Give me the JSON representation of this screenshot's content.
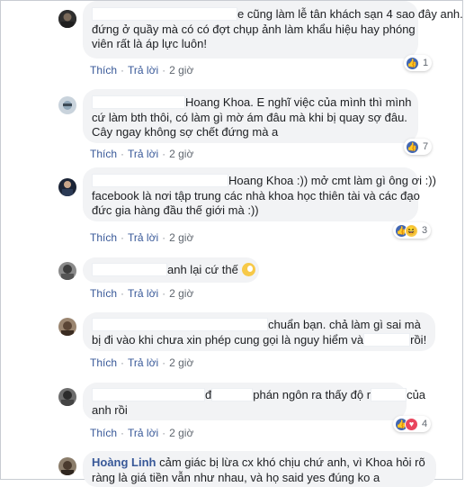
{
  "actions": {
    "like": "Thích",
    "reply": "Trả lời",
    "time": "2 giờ",
    "separator": "·"
  },
  "comments": [
    {
      "lines": [
        "e cũng làm lễ tân khách sạn 4 sao đây anh.",
        "đứng ở quầy mà có có đợt chụp ảnh làm khẩu hiệu hay phóng",
        "viên rất là áp lực luôn!"
      ],
      "reactions": {
        "count": "1"
      }
    },
    {
      "mention": "Hoang Khoa",
      "lines": [
        ". E nghĩ việc của mình thì mình",
        "cứ làm bth thôi, có làm gì mờ ám đâu mà khi bị quay sợ đâu.",
        "Cây ngay không sợ chết đứng mà a"
      ],
      "reactions": {
        "count": "7"
      }
    },
    {
      "mention": "Hoang Khoa",
      "lines": [
        " :)) mở cmt làm gì ông ơi :))",
        "facebook là nơi tập trung các nhà khoa học thiên tài và các đạo",
        "đức gia hàng đầu thế giới mà :))"
      ],
      "reactions": {
        "count": "3"
      }
    },
    {
      "lines": [
        "anh lại cứ thế"
      ],
      "reactions": null
    },
    {
      "lines": [
        "chuẩn bạn. chả làm gì sai mà",
        "bị đi vào khi chưa xin phép cung gọi là nguy hiểm và",
        "rồi!"
      ],
      "reactions": null
    },
    {
      "lines": [
        "đ",
        "phán ngôn ra thấy độ r",
        "của",
        "anh rồi"
      ],
      "reactions": {
        "count": "4"
      }
    },
    {
      "name": "Hoàng Linh",
      "lines": [
        " cảm giác bị lừa cx khó chịu chứ anh, vì Khoa hỏi rõ",
        "ràng là giá tiền vẫn như nhau, và họ said yes đúng ko a"
      ],
      "reactions": null
    }
  ],
  "icons": {
    "like": "like-icon",
    "haha": "haha-icon",
    "love": "love-icon",
    "emoji": "blush-emoji-icon"
  },
  "colors": {
    "bubble": "#f2f3f5",
    "link": "#385898",
    "meta": "#606770",
    "like": "#4267b2"
  }
}
